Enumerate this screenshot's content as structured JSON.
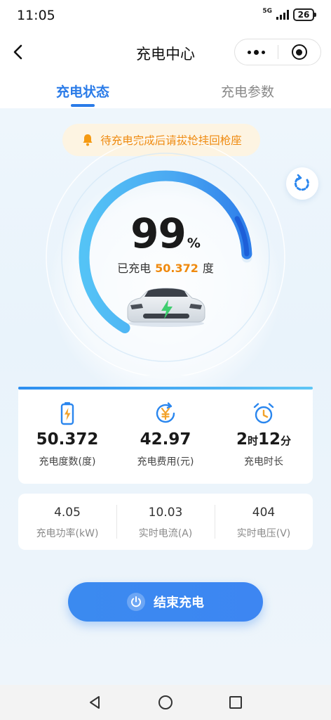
{
  "status_bar": {
    "time": "11:05",
    "network": "5G",
    "battery": "26"
  },
  "nav": {
    "title": "充电中心"
  },
  "tabs": [
    {
      "label": "充电状态",
      "active": true
    },
    {
      "label": "充电参数",
      "active": false
    }
  ],
  "notice": {
    "text": "待充电完成后请拔枪挂回枪座",
    "icon": "bell-icon"
  },
  "gauge": {
    "percent": "99",
    "percent_sign": "%",
    "charged_prefix": "已充电",
    "charged_value": "50.372",
    "charged_unit": "度",
    "level_fraction": 0.99
  },
  "stats": [
    {
      "icon": "battery-bolt-icon",
      "value": "50.372",
      "label": "充电度数(度)"
    },
    {
      "icon": "yen-refresh-icon",
      "value": "42.97",
      "label": "充电费用(元)"
    },
    {
      "icon": "alarm-clock-icon",
      "hours": "2",
      "hours_unit": "时",
      "minutes": "12",
      "minutes_unit": "分",
      "label": "充电时长"
    }
  ],
  "metrics": [
    {
      "value": "4.05",
      "label": "充电功率(kW)"
    },
    {
      "value": "10.03",
      "label": "实时电流(A)"
    },
    {
      "value": "404",
      "label": "实时电压(V)"
    }
  ],
  "end_button": {
    "label": "结束充电"
  },
  "colors": {
    "accent": "#2a7be8",
    "notice_text": "#ef8a0f",
    "notice_bg": "#fdf4e2",
    "button": "#3b8af0"
  }
}
